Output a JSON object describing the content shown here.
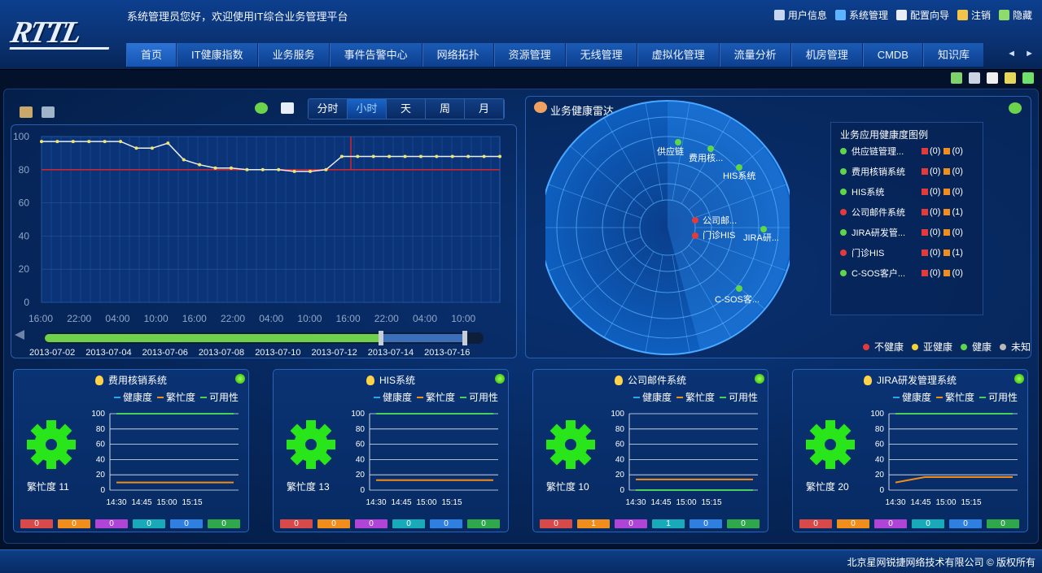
{
  "header": {
    "logo": "RTTL",
    "welcome": "系统管理员您好，欢迎使用IT综合业务管理平台",
    "links": [
      {
        "label": "用户信息",
        "icon": "user-info-icon",
        "color": "#c7d6f0"
      },
      {
        "label": "系统管理",
        "icon": "settings-icon",
        "color": "#5db3ff"
      },
      {
        "label": "配置向导",
        "icon": "wizard-icon",
        "color": "#e9eef6"
      },
      {
        "label": "注销",
        "icon": "logout-icon",
        "color": "#f2c54a"
      },
      {
        "label": "隐藏",
        "icon": "hide-icon",
        "color": "#8fdc6c"
      }
    ]
  },
  "nav": {
    "tabs": [
      "首页",
      "IT健康指数",
      "业务服务",
      "事件告警中心",
      "网络拓扑",
      "资源管理",
      "无线管理",
      "虚拟化管理",
      "流量分析",
      "机房管理",
      "CMDB",
      "知识库"
    ],
    "active": 0,
    "arrows": "◄ ►"
  },
  "toolbar2": [
    {
      "icon": "export-icon",
      "color": "#7fd36d"
    },
    {
      "icon": "display-icon",
      "color": "#c9d3e2"
    },
    {
      "icon": "gear-icon",
      "color": "#f0f0f0"
    },
    {
      "icon": "back-icon",
      "color": "#e5d75a"
    },
    {
      "icon": "fullscreen-icon",
      "color": "#6fe06b"
    }
  ],
  "timeline": {
    "buttons": [
      "分时",
      "小时",
      "天",
      "周",
      "月"
    ],
    "active": 1,
    "dates": [
      "2013-07-02",
      "2013-07-04",
      "2013-07-06",
      "2013-07-08",
      "2013-07-10",
      "2013-07-12",
      "2013-07-14",
      "2013-07-16"
    ]
  },
  "chart_data": [
    {
      "type": "line",
      "x": [
        "16:00",
        "22:00",
        "04:00",
        "10:00",
        "16:00",
        "22:00",
        "04:00",
        "10:00",
        "16:00",
        "22:00",
        "04:00",
        "10:00"
      ],
      "ylim": [
        0,
        100
      ],
      "yticks": [
        0,
        20,
        40,
        60,
        80,
        100
      ],
      "threshold": 80,
      "series": [
        {
          "values": [
            97,
            97,
            97,
            97,
            97,
            97,
            93,
            93,
            96,
            86,
            83,
            81,
            81,
            80,
            80,
            80,
            79,
            79,
            80,
            88,
            88,
            88,
            88,
            88,
            88,
            88,
            88,
            88,
            88,
            88
          ]
        }
      ]
    },
    {
      "type": "line",
      "card": "费用核销系统",
      "x": [
        "14:30",
        "14:45",
        "15:00",
        "15:15"
      ],
      "ylim": [
        0,
        100
      ],
      "yticks": [
        0,
        20,
        40,
        60,
        80,
        100
      ],
      "series": [
        {
          "values": [
            100,
            100,
            100,
            100,
            100
          ]
        },
        {
          "values": [
            10,
            10,
            10,
            10,
            10
          ]
        }
      ]
    },
    {
      "type": "line",
      "card": "HIS系统",
      "x": [
        "14:30",
        "14:45",
        "15:00",
        "15:15"
      ],
      "ylim": [
        0,
        100
      ],
      "yticks": [
        0,
        20,
        40,
        60,
        80,
        100
      ],
      "series": [
        {
          "values": [
            100,
            100,
            100,
            100,
            100
          ]
        },
        {
          "values": [
            13,
            13,
            13,
            13,
            13
          ]
        }
      ]
    },
    {
      "type": "line",
      "card": "公司邮件系统",
      "x": [
        "14:30",
        "14:45",
        "15:00",
        "15:15"
      ],
      "ylim": [
        0,
        100
      ],
      "yticks": [
        0,
        20,
        40,
        60,
        80,
        100
      ],
      "series": [
        {
          "values": [
            14,
            14,
            14,
            14,
            14
          ]
        },
        {
          "values": [
            0,
            0,
            0,
            0,
            0
          ]
        }
      ]
    },
    {
      "type": "line",
      "card": "JIRA研发管理系统",
      "x": [
        "14:30",
        "14:45",
        "15:00",
        "15:15"
      ],
      "ylim": [
        0,
        100
      ],
      "yticks": [
        0,
        20,
        40,
        60,
        80,
        100
      ],
      "series": [
        {
          "values": [
            100,
            100,
            100,
            100,
            100
          ]
        },
        {
          "values": [
            10,
            17,
            17,
            17,
            17
          ]
        }
      ]
    }
  ],
  "radar": {
    "title": "业务健康雷达",
    "legend_title": "业务应用健康度图例",
    "points": [
      {
        "label": "供应链",
        "color": "#5fd64a"
      },
      {
        "label": "费用核...",
        "color": "#5fd64a"
      },
      {
        "label": "HIS系统",
        "color": "#5fd64a"
      },
      {
        "label": "公司邮...",
        "color": "#e23b3b"
      },
      {
        "label": "门诊HIS",
        "color": "#e23b3b"
      },
      {
        "label": "JIRA研...",
        "color": "#5fd64a"
      },
      {
        "label": "C-SOS客...",
        "color": "#5fd64a"
      }
    ],
    "apps": [
      {
        "name": "供应链管理...",
        "c": "#5fd64a",
        "r": "(0)",
        "o": "(0)"
      },
      {
        "name": "费用核销系统",
        "c": "#5fd64a",
        "r": "(0)",
        "o": "(0)"
      },
      {
        "name": "HIS系统",
        "c": "#5fd64a",
        "r": "(0)",
        "o": "(0)"
      },
      {
        "name": "公司邮件系统",
        "c": "#e23b3b",
        "r": "(0)",
        "o": "(1)"
      },
      {
        "name": "JIRA研发管...",
        "c": "#5fd64a",
        "r": "(0)",
        "o": "(0)"
      },
      {
        "name": "门诊HIS",
        "c": "#e23b3b",
        "r": "(0)",
        "o": "(1)"
      },
      {
        "name": "C-SOS客户...",
        "c": "#5fd64a",
        "r": "(0)",
        "o": "(0)"
      }
    ],
    "health_legend": [
      {
        "label": "不健康",
        "c": "#e23b3b"
      },
      {
        "label": "亚健康",
        "c": "#f2d13a"
      },
      {
        "label": "健康",
        "c": "#5fd64a"
      },
      {
        "label": "未知",
        "c": "#b8b8b8"
      }
    ]
  },
  "cards": [
    {
      "title": "费用核销系统",
      "busy": "繁忙度 11",
      "legend": [
        "健康度",
        "繁忙度",
        "可用性"
      ],
      "counts": [
        "0",
        "0",
        "0",
        "0",
        "0",
        "0"
      ]
    },
    {
      "title": "HIS系统",
      "busy": "繁忙度 13",
      "legend": [
        "健康度",
        "繁忙度",
        "可用性"
      ],
      "counts": [
        "0",
        "0",
        "0",
        "0",
        "0",
        "0"
      ]
    },
    {
      "title": "公司邮件系统",
      "busy": "繁忙度 10",
      "legend": [
        "健康度",
        "繁忙度",
        "可用性"
      ],
      "counts": [
        "0",
        "1",
        "0",
        "1",
        "0",
        "0"
      ]
    },
    {
      "title": "JIRA研发管理系统",
      "busy": "繁忙度 20",
      "legend": [
        "健康度",
        "繁忙度",
        "可用性"
      ],
      "counts": [
        "0",
        "0",
        "0",
        "0",
        "0",
        "0"
      ]
    }
  ],
  "count_colors": [
    "#d84a4a",
    "#f08d1b",
    "#b044d6",
    "#18aab8",
    "#2f7fe0",
    "#2ea84a"
  ],
  "series_colors": {
    "health": "#2aa7e8",
    "busy": "#f08d1b",
    "avail": "#48d15a",
    "threshold": "#d9232a"
  },
  "footer": "北京星网锐捷网络技术有限公司 © 版权所有"
}
